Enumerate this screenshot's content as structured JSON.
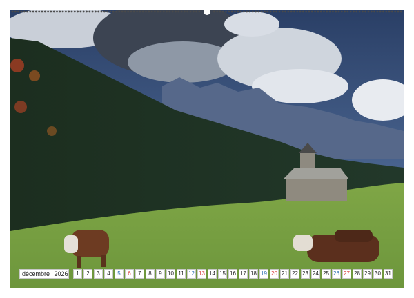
{
  "calendar": {
    "month": "décembre",
    "year": "2026",
    "days": [
      {
        "n": "1",
        "k": "w"
      },
      {
        "n": "2",
        "k": "w"
      },
      {
        "n": "3",
        "k": "w"
      },
      {
        "n": "4",
        "k": "w"
      },
      {
        "n": "5",
        "k": "sat"
      },
      {
        "n": "6",
        "k": "sun"
      },
      {
        "n": "7",
        "k": "w"
      },
      {
        "n": "8",
        "k": "w"
      },
      {
        "n": "9",
        "k": "w"
      },
      {
        "n": "10",
        "k": "w"
      },
      {
        "n": "11",
        "k": "w"
      },
      {
        "n": "12",
        "k": "sat"
      },
      {
        "n": "13",
        "k": "sun"
      },
      {
        "n": "14",
        "k": "w"
      },
      {
        "n": "15",
        "k": "w"
      },
      {
        "n": "16",
        "k": "w"
      },
      {
        "n": "17",
        "k": "w"
      },
      {
        "n": "18",
        "k": "w"
      },
      {
        "n": "19",
        "k": "sat"
      },
      {
        "n": "20",
        "k": "sun"
      },
      {
        "n": "21",
        "k": "w"
      },
      {
        "n": "22",
        "k": "w"
      },
      {
        "n": "23",
        "k": "w"
      },
      {
        "n": "24",
        "k": "w"
      },
      {
        "n": "25",
        "k": "w"
      },
      {
        "n": "26",
        "k": "sat"
      },
      {
        "n": "27",
        "k": "sun"
      },
      {
        "n": "28",
        "k": "w"
      },
      {
        "n": "29",
        "k": "w"
      },
      {
        "n": "30",
        "k": "w"
      },
      {
        "n": "31",
        "k": "w"
      }
    ]
  },
  "colors": {
    "saturday": "#2f6fb3",
    "sunday": "#d83a3a"
  }
}
